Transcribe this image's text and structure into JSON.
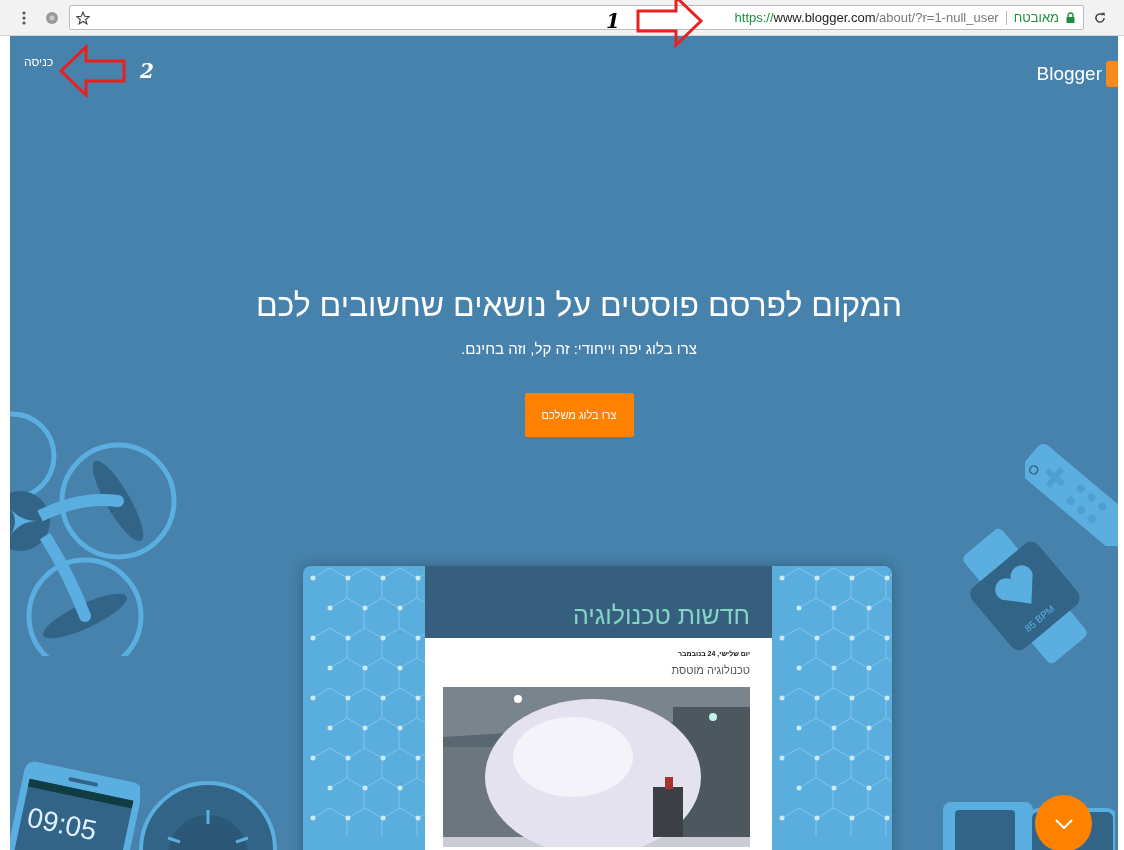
{
  "browser": {
    "secure_label": "מאובטח",
    "url_scheme": "https://",
    "url_host": "www.blogger.com",
    "url_path": "/about/?r=1-null_user"
  },
  "annotations": [
    {
      "number": "1",
      "kind": "arrow-right"
    },
    {
      "number": "2",
      "kind": "arrow-left"
    }
  ],
  "header": {
    "logo": "Blogger",
    "sign_in": "כניסה"
  },
  "hero": {
    "title": "המקום לפרסם פוסטים על נושאים שחשובים לכם",
    "subtitle": "צרו בלוג יפה וייחודי: זה קל, וזה בחינם.",
    "cta": "צרו בלוג משלכם"
  },
  "preview": {
    "blog_title": "חדשות טכנולוגיה",
    "date": "יום שלישי, 24 בנובמבר",
    "post_title": "טכנולוגיה מוטסת"
  },
  "decorations": {
    "phone_time": "09:05",
    "watch_reading": "85 BPM"
  }
}
